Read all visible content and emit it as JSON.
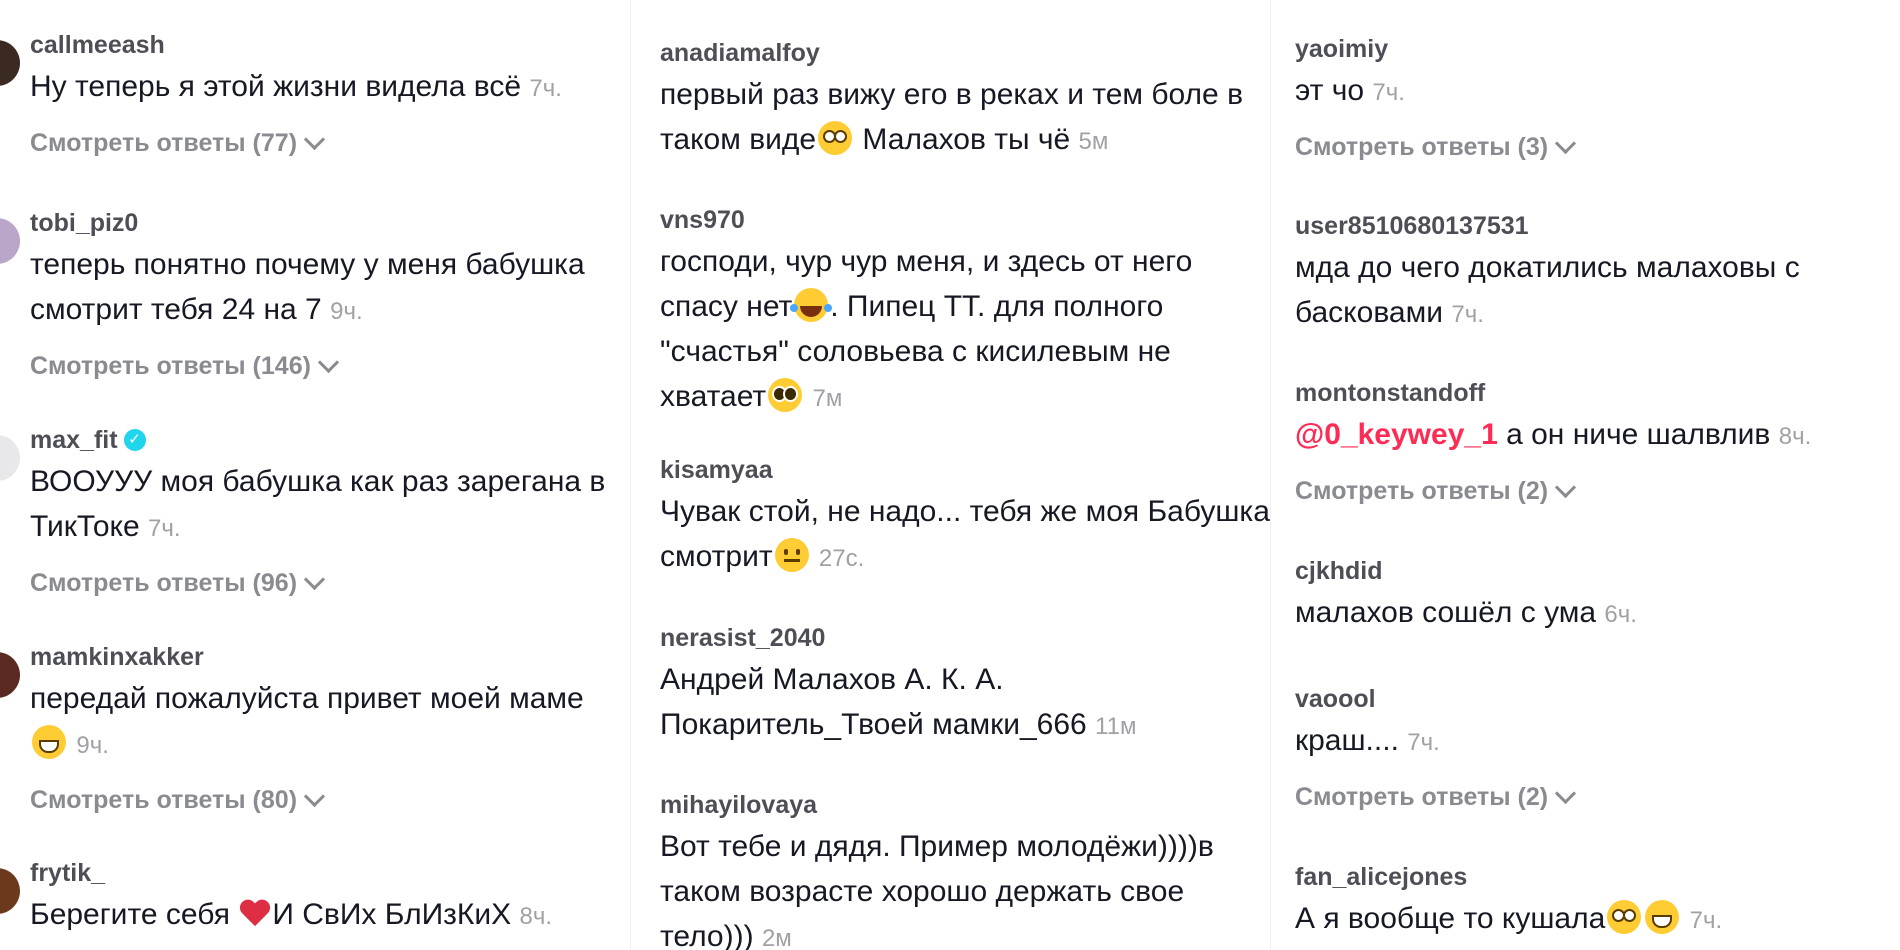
{
  "columns": [
    {
      "comments": [
        {
          "username": "callmeeash",
          "text": "Ну теперь я этой жизни видела всё",
          "time": "7ч.",
          "replies": "Смотреть ответы (77)"
        },
        {
          "username": "tobi_piz0",
          "text": "теперь понятно почему у меня бабушка смотрит тебя 24 на 7",
          "time": "9ч.",
          "replies": "Смотреть ответы (146)"
        },
        {
          "username": "max_fit",
          "verified": true,
          "text": "ВООУУУ моя бабушка как раз зарегана в ТикТоке",
          "time": "7ч.",
          "replies": "Смотреть ответы (96)"
        },
        {
          "username": "mamkinxakker",
          "text": "передай пожалуйста привет моей маме",
          "emoji": "grin",
          "time": "9ч.",
          "replies": "Смотреть ответы (80)"
        },
        {
          "username": "frytik_",
          "text_before": "Берегите себя",
          "emoji": "heart",
          "text_after": "И СвИх БлИзКиХ",
          "time": "8ч."
        }
      ]
    },
    {
      "comments": [
        {
          "username": "anadiamalfoy",
          "text_before": "первый раз вижу его в реках и тем боле в таком виде",
          "emoji": "flushed",
          "text_after": " Малахов ты чё",
          "time": "5м"
        },
        {
          "username": "vns970",
          "text_before": "господи, чур чур меня, и здесь от него спасу нет",
          "emoji": "laugh",
          "text_after": ". Пипец ТТ. для полного \"счастья\" соловьева с кисилевым не хватает",
          "emoji2": "pleading",
          "time": "7м"
        },
        {
          "username": "kisamyaa",
          "text": "Чувак стой, не надо... тебя же моя Бабушка смотрит",
          "emoji": "neutral",
          "time": "27с."
        },
        {
          "username": "nerasist_2040",
          "text": "Андрей Малахов А. К. А. Покаритель_Твоей мамки_666",
          "time": "11м"
        },
        {
          "username": "mihayilovaya",
          "text": "Вот тебе и дядя. Пример молодёжи))))в таком возрасте хорошо держать свое тело)))",
          "time": "2м"
        }
      ]
    },
    {
      "comments": [
        {
          "username": "yaoimiy",
          "text": "эт чо",
          "time": "7ч.",
          "replies": "Смотреть ответы (3)"
        },
        {
          "username": "user8510680137531",
          "text": "мда до чего докатились малаховы с басковами",
          "time": "7ч."
        },
        {
          "username": "montonstandoff",
          "mention": "@0_keywey_1",
          "text": " а он ниче шалвлив",
          "time": "8ч.",
          "replies": "Смотреть ответы (2)"
        },
        {
          "username": "cjkhdid",
          "text": "малахов сошёл с ума",
          "time": "6ч."
        },
        {
          "username": "vaoool",
          "text": "краш....",
          "time": "7ч.",
          "replies": "Смотреть ответы (2)"
        },
        {
          "username": "fan_alicejones",
          "text": "А я вообще то кушала",
          "emoji": "flushed",
          "emoji2": "grimace",
          "time": "7ч."
        }
      ]
    }
  ]
}
